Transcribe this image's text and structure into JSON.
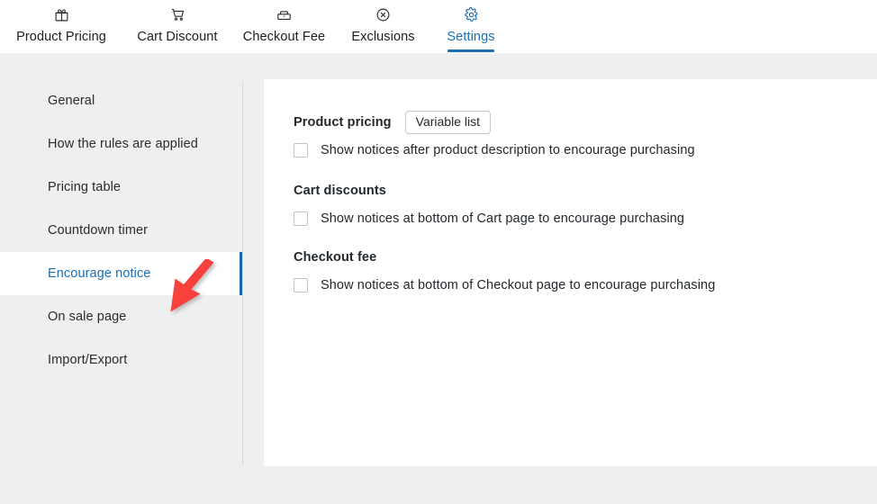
{
  "topbar": {
    "tabs": [
      {
        "label": "Product Pricing",
        "icon": "gift-icon",
        "active": false
      },
      {
        "label": "Cart Discount",
        "icon": "cart-icon",
        "active": false
      },
      {
        "label": "Checkout Fee",
        "icon": "checkout-icon",
        "active": false
      },
      {
        "label": "Exclusions",
        "icon": "circle-x-icon",
        "active": false
      },
      {
        "label": "Settings",
        "icon": "gear-icon",
        "active": true
      }
    ]
  },
  "sidebar": {
    "items": [
      {
        "label": "General",
        "active": false
      },
      {
        "label": "How the rules are applied",
        "active": false
      },
      {
        "label": "Pricing table",
        "active": false
      },
      {
        "label": "Countdown timer",
        "active": false
      },
      {
        "label": "Encourage notice",
        "active": true
      },
      {
        "label": "On sale page",
        "active": false
      },
      {
        "label": "Import/Export",
        "active": false
      }
    ]
  },
  "main": {
    "sections": [
      {
        "title": "Product pricing",
        "button": "Variable list",
        "checkbox_label": "Show notices after product description to encourage purchasing",
        "checked": false
      },
      {
        "title": "Cart discounts",
        "button": null,
        "checkbox_label": "Show notices at bottom of Cart page to encourage purchasing",
        "checked": false
      },
      {
        "title": "Checkout fee",
        "button": null,
        "checkbox_label": "Show notices at bottom of Checkout page to encourage purchasing",
        "checked": false
      }
    ]
  },
  "annotation": {
    "arrow": "red-arrow-pointing-to-encourage-notice"
  },
  "colors": {
    "accent": "#1a6fb5",
    "active_bar": "#1a6aaf",
    "page_bg": "#efeff0",
    "panel_bg": "#ffffff",
    "text": "#23282d",
    "arrow": "#f8403c"
  }
}
